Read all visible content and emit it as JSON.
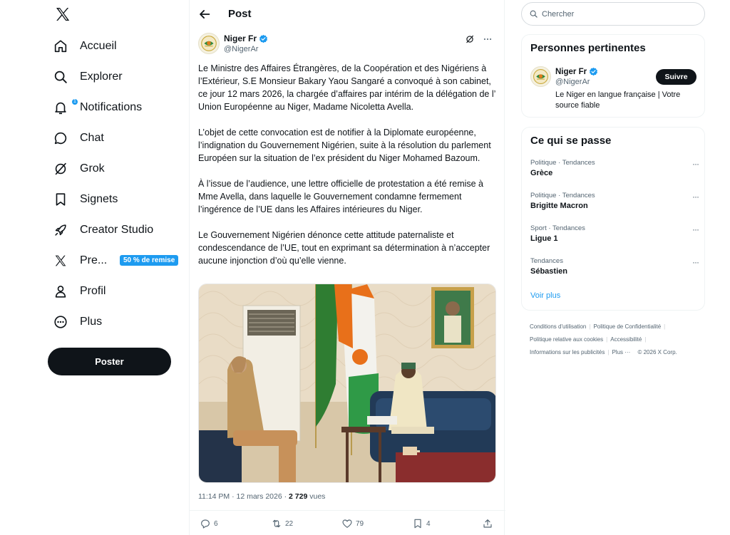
{
  "nav": {
    "items": [
      {
        "label": "Accueil",
        "icon": "home-icon"
      },
      {
        "label": "Explorer",
        "icon": "search-icon"
      },
      {
        "label": "Notifications",
        "icon": "bell-icon",
        "badge": "1"
      },
      {
        "label": "Chat",
        "icon": "chat-icon"
      },
      {
        "label": "Grok",
        "icon": "grok-icon"
      },
      {
        "label": "Signets",
        "icon": "bookmark-icon"
      },
      {
        "label": "Creator Studio",
        "icon": "rocket-icon"
      },
      {
        "label": "Pre...",
        "icon": "x-logo-icon",
        "promo": "50 % de remise"
      },
      {
        "label": "Profil",
        "icon": "person-icon"
      },
      {
        "label": "Plus",
        "icon": "more-circle-icon"
      }
    ],
    "post_button": "Poster"
  },
  "header": {
    "title": "Post"
  },
  "post": {
    "author_name": "Niger Fr",
    "author_handle": "@NigerAr",
    "paragraphs": [
      "Le Ministre des Affaires Étrangères, de la Coopération et des Nigériens à l’Extérieur, S.E Monsieur Bakary Yaou Sangaré a convoqué à son cabinet, ce jour 12 mars 2026, la chargée d’affaires par intérim de la délégation de l’ Union Européenne au Niger, Madame Nicoletta Avella.",
      "L’objet de cette convocation est de notifier à la Diplomate européenne, l’indignation du Gouvernement Nigérien, suite à la résolution du parlement Européen sur la situation de l’ex président du Niger Mohamed Bazoum.",
      "À l’issue de l’audience, une lettre officielle de protestation a été remise à Mme Avella, dans laquelle le Gouvernement condamne fermement l’ingérence de l’UE dans les Affaires intérieures du Niger.",
      "Le Gouvernement Nigérien dénonce cette attitude paternaliste et condescendance de l’UE, tout en exprimant sa détermination à n’accepter aucune injonction d’où qu’elle vienne."
    ],
    "timestamp": "11:14 PM · 12 mars 2026 · ",
    "views_count": "2 729",
    "views_label": " vues",
    "replies": "6",
    "reposts": "22",
    "likes": "79",
    "bookmarks": "4"
  },
  "search": {
    "placeholder": "Chercher"
  },
  "relevant": {
    "title": "Personnes pertinentes",
    "name": "Niger Fr",
    "handle": "@NigerAr",
    "bio": "Le Niger en langue française | Votre source fiable",
    "follow_label": "Suivre"
  },
  "trends": {
    "title": "Ce qui se passe",
    "items": [
      {
        "category": "Politique · Tendances",
        "name": "Grèce"
      },
      {
        "category": "Politique · Tendances",
        "name": "Brigitte Macron"
      },
      {
        "category": "Sport · Tendances",
        "name": "Ligue 1"
      },
      {
        "category": "Tendances",
        "name": "Sébastien"
      }
    ],
    "more": "Voir plus"
  },
  "footer": {
    "terms": "Conditions d'utilisation",
    "privacy": "Politique de Confidentialité",
    "cookies": "Politique relative aux cookies",
    "accessibility": "Accessibilité",
    "ads": "Informations sur les publicités",
    "more": "Plus ···",
    "copyright": "© 2026 X Corp."
  },
  "colors": {
    "accent": "#1d9bf0",
    "text": "#0f1419",
    "muted": "#536471",
    "button": "#0f1419"
  }
}
